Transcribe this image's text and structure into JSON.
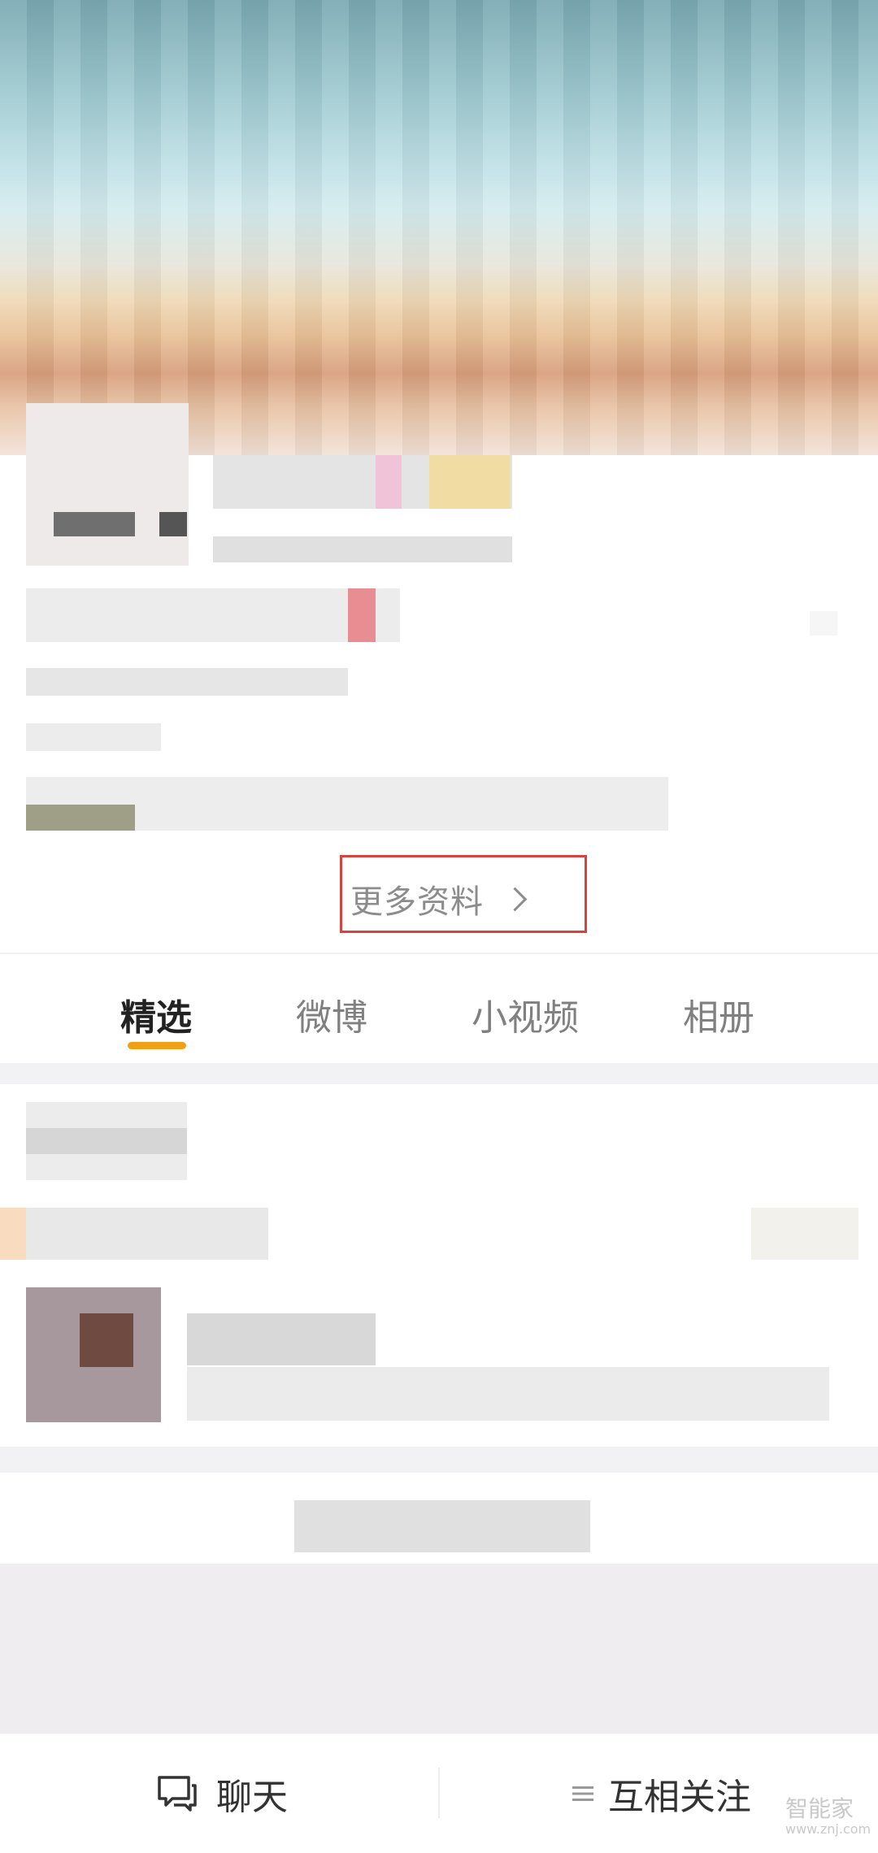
{
  "profile": {
    "more_info_label": "更多资料"
  },
  "tabs": [
    {
      "label": "精选",
      "active": true
    },
    {
      "label": "微博",
      "active": false
    },
    {
      "label": "小视频",
      "active": false
    },
    {
      "label": "相册",
      "active": false
    }
  ],
  "bottom_bar": {
    "chat_label": "聊天",
    "follow_label": "互相关注"
  },
  "watermark": {
    "brand": "智能家",
    "url": "www.znj.com"
  },
  "colors": {
    "accent_underline": "#f0a017",
    "highlight_box": "#d9433d"
  },
  "icons": {
    "chat": "chat-bubbles-icon",
    "follow": "menu-lines-icon",
    "more_info": "chevron-right-icon"
  }
}
